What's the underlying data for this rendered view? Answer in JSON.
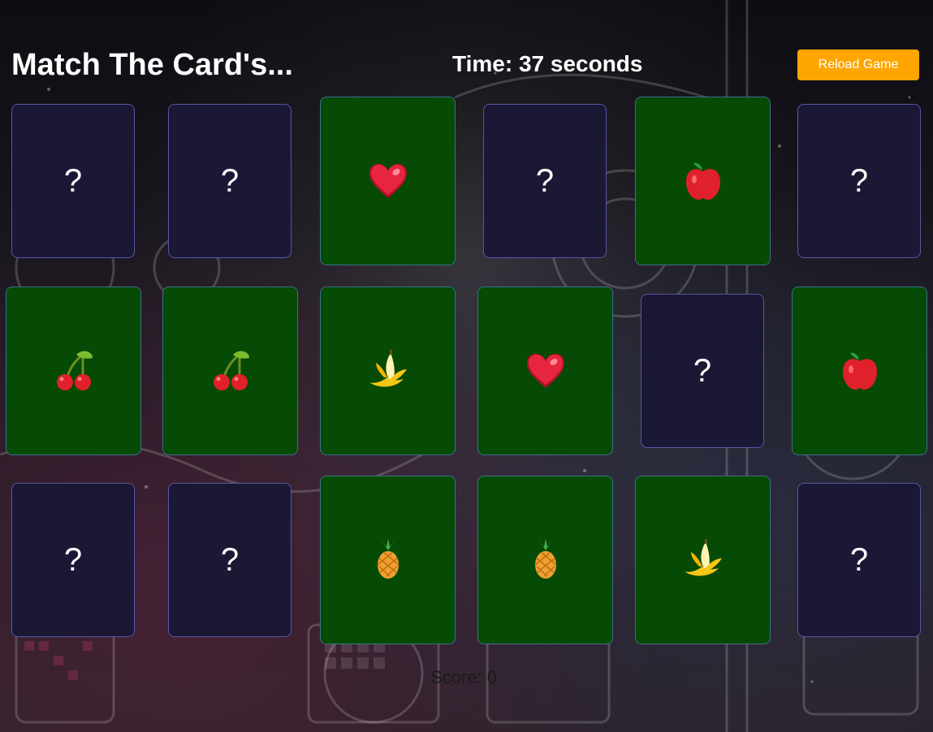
{
  "header": {
    "title": "Match The Card's...",
    "timer": "Time: 37 seconds",
    "reload_label": "Reload Game"
  },
  "colors": {
    "accent": "#ffa500",
    "card_back": "#1a1834",
    "card_back_border": "#5a55a6",
    "card_face": "#054a05"
  },
  "cards": [
    {
      "state": "hidden",
      "symbol": "?"
    },
    {
      "state": "hidden",
      "symbol": "?"
    },
    {
      "state": "flipped",
      "icon": "heart"
    },
    {
      "state": "hidden",
      "symbol": "?"
    },
    {
      "state": "flipped",
      "icon": "apple"
    },
    {
      "state": "hidden",
      "symbol": "?"
    },
    {
      "state": "flipped",
      "icon": "cherries"
    },
    {
      "state": "flipped",
      "icon": "cherries"
    },
    {
      "state": "flipped",
      "icon": "banana"
    },
    {
      "state": "flipped",
      "icon": "heart"
    },
    {
      "state": "hidden",
      "symbol": "?"
    },
    {
      "state": "flipped",
      "icon": "apple"
    },
    {
      "state": "hidden",
      "symbol": "?"
    },
    {
      "state": "hidden",
      "symbol": "?"
    },
    {
      "state": "flipped",
      "icon": "pineapple"
    },
    {
      "state": "flipped",
      "icon": "pineapple"
    },
    {
      "state": "flipped",
      "icon": "banana"
    },
    {
      "state": "hidden",
      "symbol": "?"
    }
  ],
  "footer": {
    "score": "Score: 0"
  }
}
